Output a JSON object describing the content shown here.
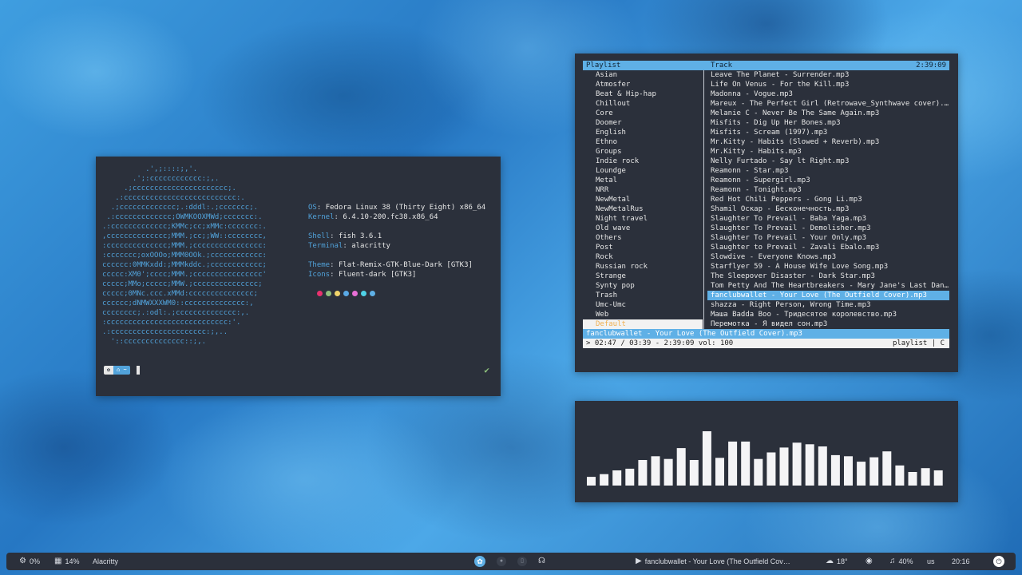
{
  "terminal": {
    "ascii_art": "          .',;::::;,'.\n       .';:cccccccccccc:;,.\n     .;cccccccccccccccccccccc;.\n   .:cccccccccccccccccccccccccc:.\n  .;ccccccccccccc;.:dddl:.;ccccccc;.\n .:ccccccccccccc;OWMKOOXMWd;ccccccc:.\n.:ccccccccccccc;KMMc;cc;xMMc:ccccccc:.\n,cccccccccccccc;MMM.;cc;;WW::cccccccc,\n:cccccccccccccc;MMM.;cccccccccccccccc:\n:ccccccc;oxOOOo;MMM0OOk.;cccccccccccc:\ncccccc:0MMKxdd:;MMMkddc.;cccccccccccc;\nccccc:XM0';cccc;MMM.;cccccccccccccccc'\nccccc;MMo;ccccc;MMW.;ccccccccccccccc;\nccccc;0MNc.ccc.xMMd:ccccccccccccccc;\ncccccc;dNMWXXXWM0::cccccccccccccc:,\ncccccccc;.:odl:.;cccccccccccccc:,.\n:cccccccccccccccccccccccccccc:'.\n.:cccccccccccccccccccccc:;,..\n  '::cccccccccccccc::;,.",
    "info": [
      {
        "key": "OS",
        "value": "Fedora Linux 38 (Thirty Eight) x86_64"
      },
      {
        "key": "Kernel",
        "value": "6.4.10-200.fc38.x86_64"
      },
      {
        "key": "Shell",
        "value": "fish 3.6.1"
      },
      {
        "key": "Terminal",
        "value": "alacritty"
      },
      {
        "key": "Theme",
        "value": "Flat-Remix-GTK-Blue-Dark [GTK3]"
      },
      {
        "key": "Icons",
        "value": "Fluent-dark [GTK3]"
      }
    ],
    "swatch_colors": [
      "#e8316e",
      "#8ec07c",
      "#f0d36a",
      "#5aa9e6",
      "#e86fd6",
      "#4fd1e6",
      "#5fb0e6"
    ],
    "prompt": {
      "os_icon": "fedora-icon",
      "path": "~"
    }
  },
  "player": {
    "header_playlist": "Playlist",
    "header_track": "Track",
    "header_time": "2:39:09",
    "playlists": [
      "Asian",
      "Atmosfer",
      "Beat & Hip-hap",
      "Chillout",
      "Core",
      "Doomer",
      "English",
      "Ethno",
      "Groups",
      "Indie rock",
      "Loundge",
      "Metal",
      "NRR",
      "NewMetal",
      "NewMetalRus",
      "Night travel",
      "Old wave",
      "Others",
      "Post",
      "Rock",
      "Russian rock",
      "Strange",
      "Synty pop",
      "Trash",
      "Umc-Umc",
      "Web",
      "Default"
    ],
    "selected_playlist": 26,
    "tracks": [
      "Leave The Planet - Surrender.mp3",
      "Life On Venus - For the Kill.mp3",
      "Madonna - Vogue.mp3",
      "Mareux - The Perfect Girl (Retrowave_Synthwave cover).m…",
      "Melanie C - Never Be The Same Again.mp3",
      "Misfits - Dig Up Her Bones.mp3",
      "Misfits - Scream (1997).mp3",
      "Mr.Kitty - Habits (Slowed + Reverb).mp3",
      "Mr.Kitty - Habits.mp3",
      "Nelly Furtado - Say lt Right.mp3",
      "Reamonn - Star.mp3",
      "Reamonn - Supergirl.mp3",
      "Reamonn - Tonight.mp3",
      "Red Hot Chili Peppers - Gong Li.mp3",
      "Shamil Оскар - Бесконечность.mp3",
      "Slaughter To Prevail - Baba Yaga.mp3",
      "Slaughter To Prevail - Demolisher.mp3",
      "Slaughter To Prevail - Your Only.mp3",
      "Slaughter to Prevail - Zavali Ebalo.mp3",
      "Slowdive - Everyone Knows.mp3",
      "Starflyer 59 - A House Wife Love Song.mp3",
      "The Sleepover Disaster - Dark Star.mp3",
      "Tom Petty And The Heartbreakers - Mary Jane's Last Danc…",
      "fanclubwallet - Your Love (The Outfield Cover).mp3",
      "shazza - Right Person, Wrong Time.mp3",
      "Маша Badda Boo - Тридесятое королевство.mp3",
      "Перемотка - Я видел сон.mp3"
    ],
    "playing_index": 23,
    "now_playing": "fanclubwallet - Your Love (The Outfield Cover).mp3",
    "status_left": "> 02:47 / 03:39 - 2:39:09 vol: 100",
    "status_right": "playlist | C"
  },
  "visualizer": {
    "levels": [
      0.16,
      0.21,
      0.28,
      0.31,
      0.47,
      0.54,
      0.49,
      0.69,
      0.47,
      1.0,
      0.51,
      0.81,
      0.81,
      0.49,
      0.61,
      0.7,
      0.79,
      0.76,
      0.72,
      0.56,
      0.54,
      0.44,
      0.52,
      0.63,
      0.37,
      0.25,
      0.32,
      0.28
    ]
  },
  "taskbar": {
    "cpu_icon": "cpu-icon",
    "cpu": "0%",
    "mem_icon": "memory-icon",
    "mem": "14%",
    "window_title": "Alacritty",
    "workspaces": [
      "fedora-icon",
      "circle-icon",
      "phone-icon",
      "headphones-icon"
    ],
    "media_icon": "play-icon",
    "media_title": "fanclubwallet - Your Love (The Outfield Cov…",
    "weather_icon": "cloud-icon",
    "weather": "18°",
    "volume_icon": "speaker-icon",
    "volume": "40%",
    "keyboard": "us",
    "clock": "20:16",
    "power_icon": "power-icon"
  }
}
